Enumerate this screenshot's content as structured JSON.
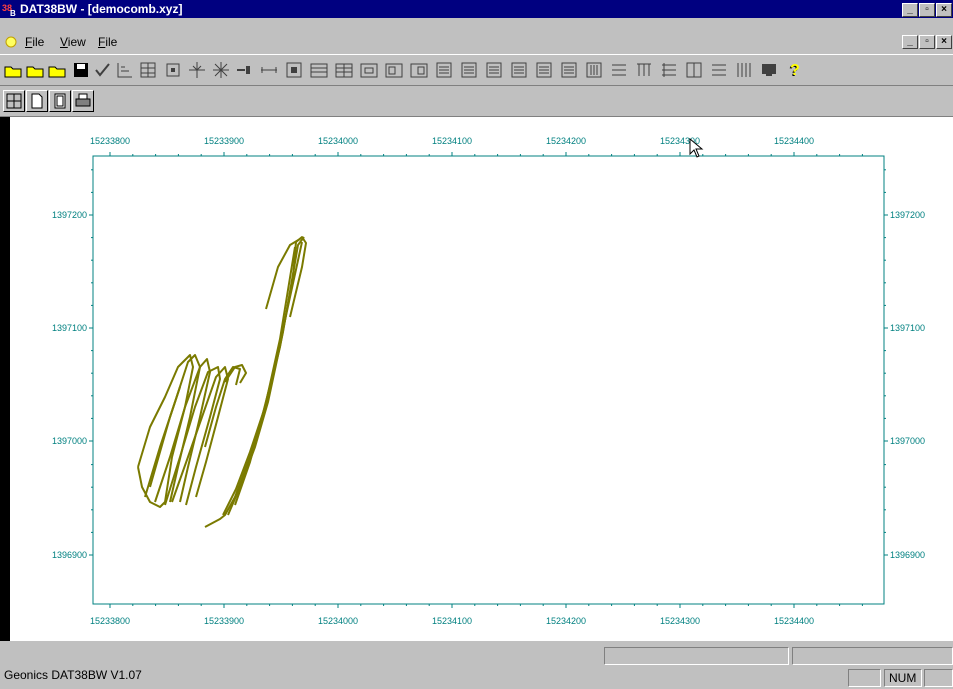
{
  "window": {
    "title": "DAT38BW - [democomb.xyz]",
    "controls": [
      "_",
      "▫",
      "×"
    ]
  },
  "menu": {
    "items": [
      {
        "label": "File",
        "underline": "F"
      },
      {
        "label": "View",
        "underline": "V"
      },
      {
        "label": "File",
        "underline": "F"
      }
    ]
  },
  "toolbar": {
    "icons": [
      "open-icon",
      "open-alt-icon",
      "open-folder-icon",
      "save-icon",
      "check-icon",
      "chart-icon",
      "grid-icon",
      "box-icon",
      "move-icon",
      "star-icon",
      "sep-icon",
      "line-icon",
      "frame-icon",
      "table-icon",
      "table2-icon",
      "panel-icon",
      "panel2-icon",
      "panel3-icon",
      "list-icon",
      "list2-icon",
      "list3-icon",
      "list4-icon",
      "list5-icon",
      "rows-icon",
      "cols-icon",
      "lines-icon",
      "window-icon",
      "lines2-icon",
      "bars-icon",
      "block-icon",
      "help-icon"
    ]
  },
  "toolbar2": {
    "icons": [
      "crosshair-icon",
      "page-icon",
      "page2-icon",
      "print-icon"
    ]
  },
  "plot": {
    "x_ticks": [
      "15233800",
      "15233900",
      "15234000",
      "15234100",
      "15234200",
      "15234300",
      "15234400"
    ],
    "y_ticks": [
      "1397200",
      "1397100",
      "1397000",
      "1396900"
    ],
    "line_color": "#7a7a00",
    "axis_color": "#008080"
  },
  "status": {
    "app_text": "Geonics DAT38BW V1.07",
    "num_indicator": "NUM"
  }
}
